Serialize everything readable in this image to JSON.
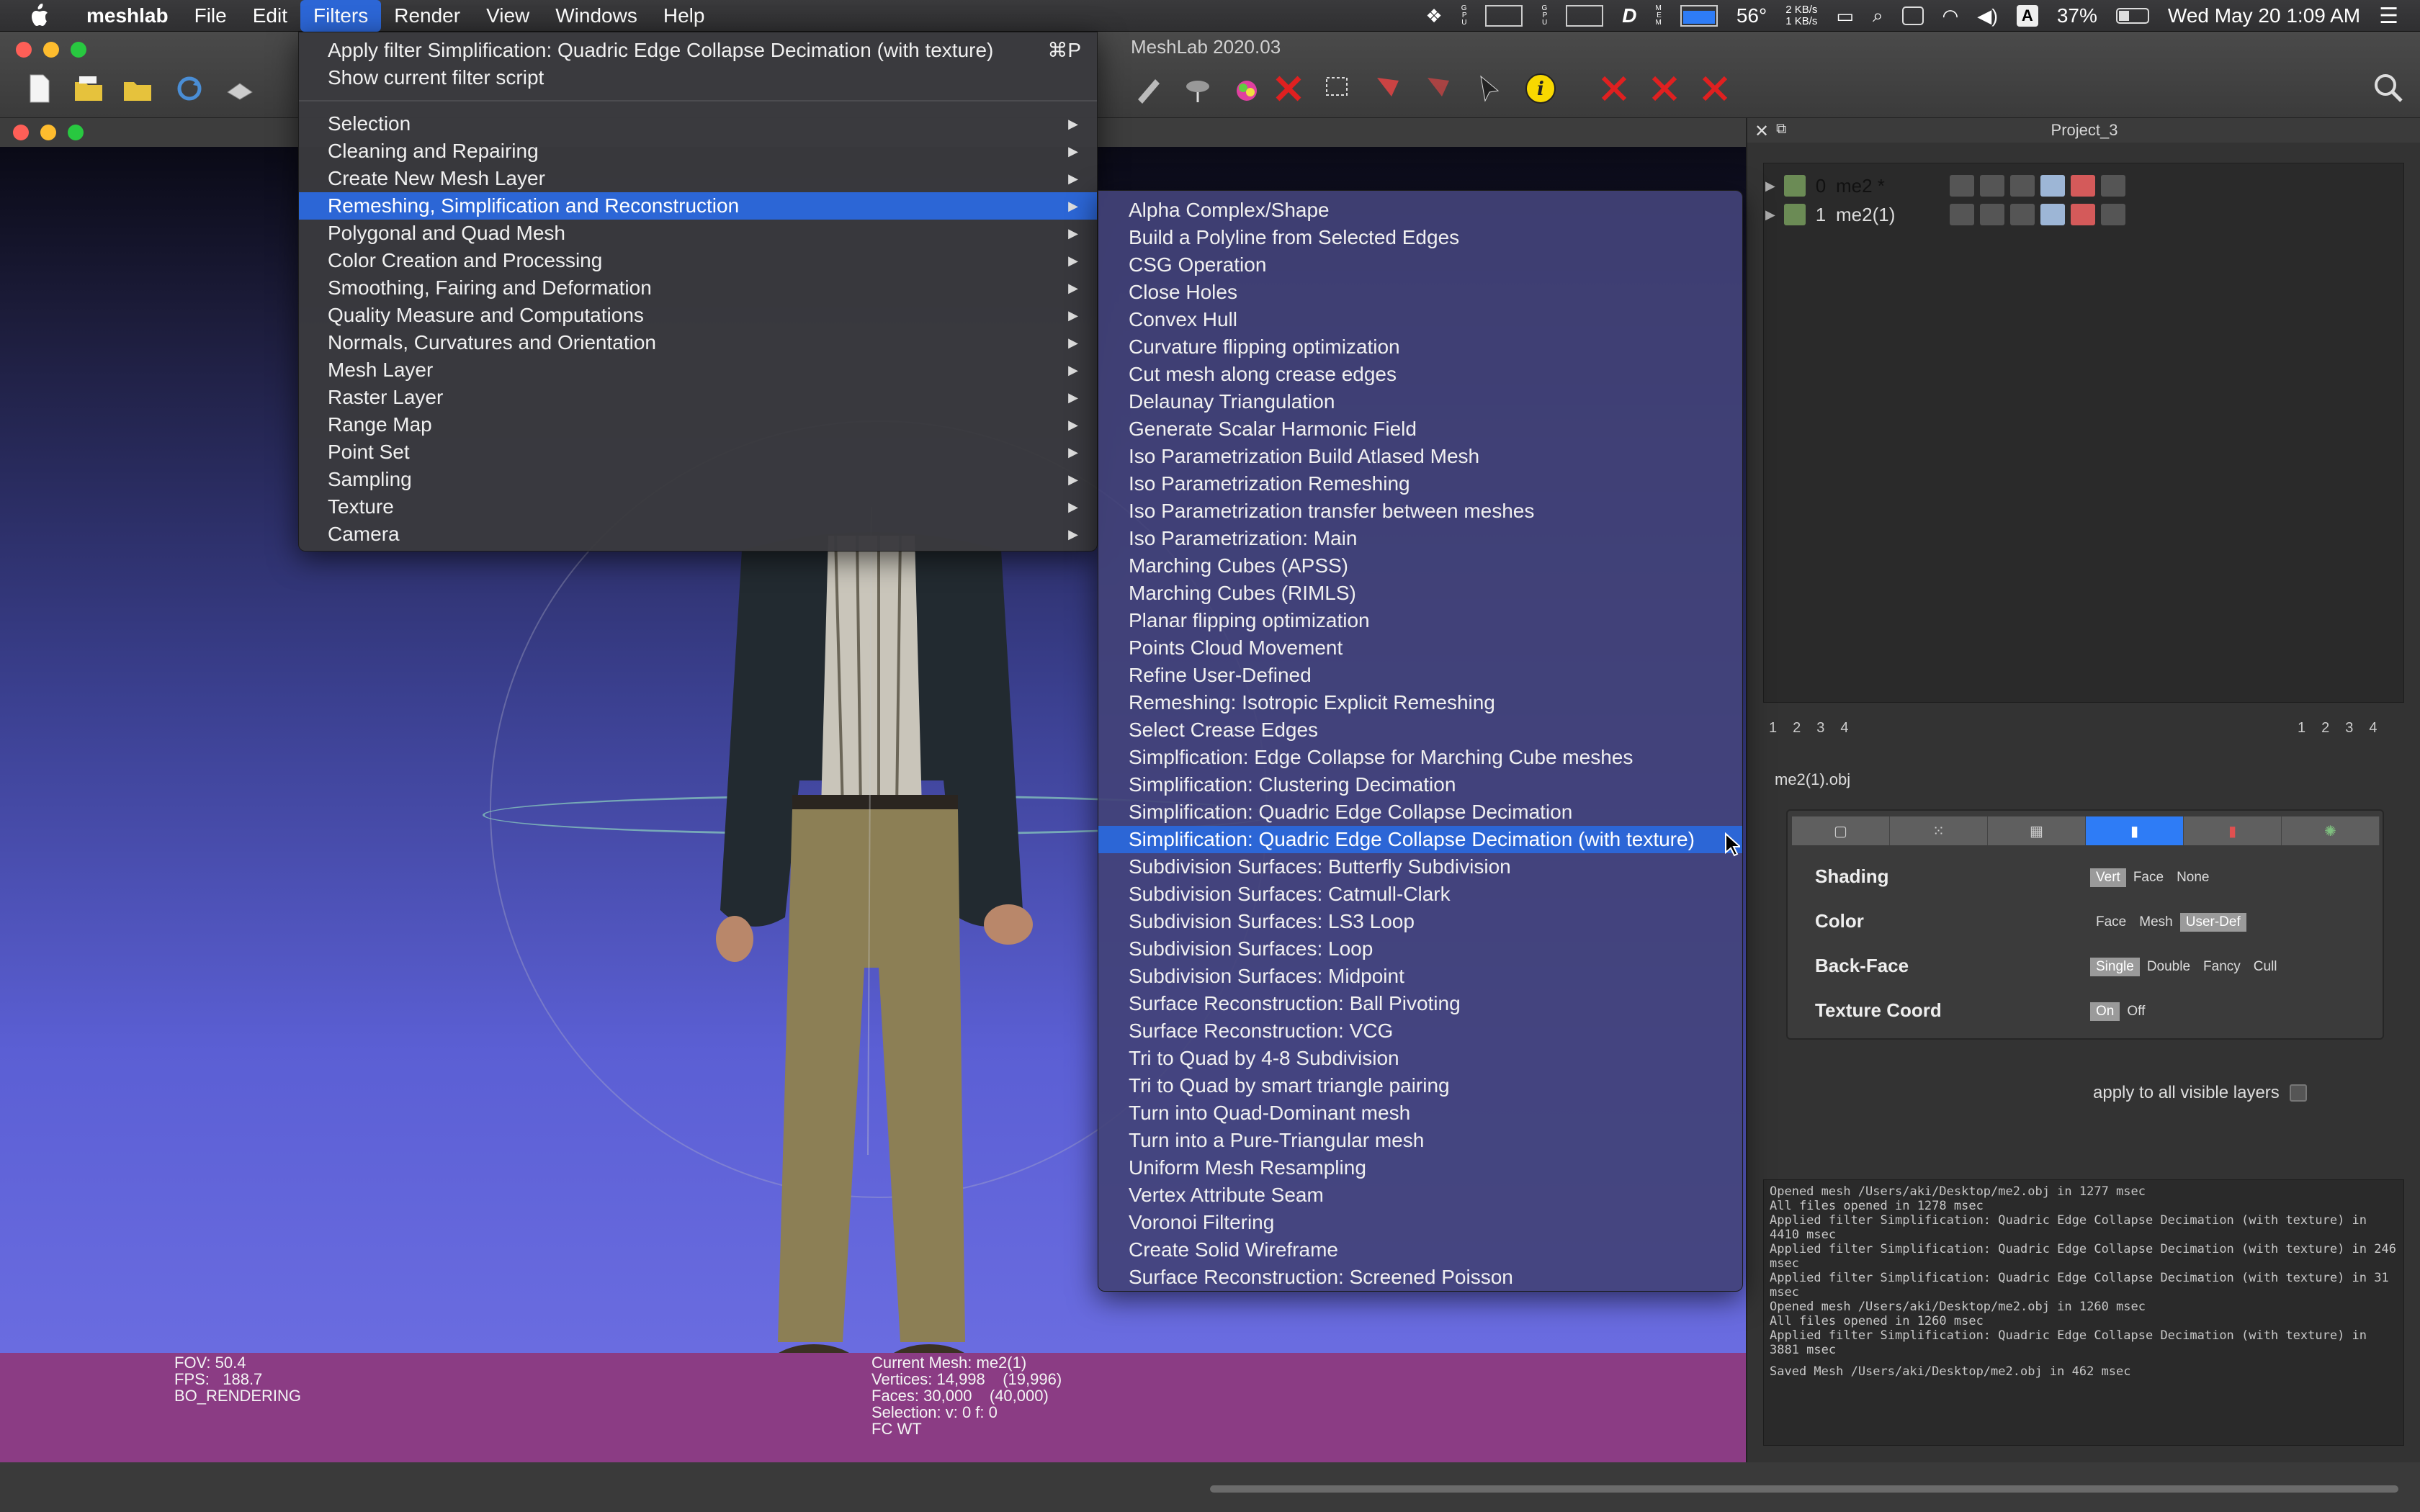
{
  "menubar": {
    "app": "meshlab",
    "menus": [
      "File",
      "Edit",
      "Filters",
      "Render",
      "View",
      "Windows",
      "Help"
    ],
    "active_menu": "Filters",
    "gpu_label_1": "G\nP\nU",
    "gpu_label_2": "G\nP\nU",
    "mem_label": "M\nE\nM",
    "d_label": "D",
    "temp": "56°",
    "net_up": "2 KB/s",
    "net_down": "1 KB/s",
    "a_label": "A",
    "battery": "37%",
    "datetime": "Wed May 20  1:09 AM"
  },
  "window": {
    "title": "MeshLab 2020.03"
  },
  "filters_menu": {
    "apply_last": "Apply filter Simplification: Quadric Edge Collapse Decimation (with texture)",
    "apply_shortcut": "⌘P",
    "show_script": "Show current filter script",
    "categories": [
      "Selection",
      "Cleaning and Repairing",
      "Create New Mesh Layer",
      "Remeshing, Simplification and Reconstruction",
      "Polygonal and Quad Mesh",
      "Color Creation and Processing",
      "Smoothing, Fairing and Deformation",
      "Quality Measure and Computations",
      "Normals, Curvatures and Orientation",
      "Mesh Layer",
      "Raster Layer",
      "Range Map",
      "Point Set",
      "Sampling",
      "Texture",
      "Camera"
    ],
    "highlighted_index": 3
  },
  "remesh_menu": {
    "items": [
      "Alpha Complex/Shape",
      "Build a Polyline from Selected Edges",
      "CSG Operation",
      "Close Holes",
      "Convex Hull",
      "Curvature flipping optimization",
      "Cut mesh along crease edges",
      "Delaunay Triangulation",
      "Generate Scalar Harmonic Field",
      "Iso Parametrization Build Atlased Mesh",
      "Iso Parametrization Remeshing",
      "Iso Parametrization transfer between meshes",
      "Iso Parametrization: Main",
      "Marching Cubes (APSS)",
      "Marching Cubes (RIMLS)",
      "Planar flipping optimization",
      "Points Cloud Movement",
      "Refine User-Defined",
      "Remeshing: Isotropic Explicit Remeshing",
      "Select Crease Edges",
      "Simplfication: Edge Collapse for Marching Cube meshes",
      "Simplification: Clustering Decimation",
      "Simplification: Quadric Edge Collapse Decimation",
      "Simplification: Quadric Edge Collapse Decimation (with texture)",
      "Subdivision Surfaces: Butterfly Subdivision",
      "Subdivision Surfaces: Catmull-Clark",
      "Subdivision Surfaces: LS3 Loop",
      "Subdivision Surfaces: Loop",
      "Subdivision Surfaces: Midpoint",
      "Surface Reconstruction: Ball Pivoting",
      "Surface Reconstruction: VCG",
      "Tri to Quad by 4-8 Subdivision",
      "Tri to Quad by smart triangle pairing",
      "Turn into Quad-Dominant mesh",
      "Turn into a Pure-Triangular mesh",
      "Uniform Mesh Resampling",
      "Vertex Attribute Seam",
      "Voronoi Filtering",
      "Create Solid Wireframe",
      "Surface Reconstruction: Screened Poisson"
    ],
    "highlighted_index": 23
  },
  "viewport_info": {
    "fov": "FOV: 50.4",
    "fps": "FPS:   188.7",
    "mode": "BO_RENDERING",
    "current_mesh": "Current Mesh: me2(1)",
    "vertices": "Vertices: 14,998    (19,996)",
    "faces": "Faces: 30,000    (40,000)",
    "selection": "Selection: v: 0 f: 0",
    "fc": "FC WT"
  },
  "project": {
    "title": "Project_3",
    "layers": [
      {
        "index": "0",
        "name": "me2 *"
      },
      {
        "index": "1",
        "name": "me2(1)"
      }
    ],
    "pager_left": [
      "1",
      "2",
      "3",
      "4"
    ],
    "pager_right": [
      "1",
      "2",
      "3",
      "4"
    ],
    "current_mesh_file": "me2(1).obj"
  },
  "render_props": {
    "shading_label": "Shading",
    "shading_options": [
      "Vert",
      "Face",
      "None"
    ],
    "color_label": "Color",
    "color_options": [
      "Face",
      "Mesh",
      "User-Def"
    ],
    "backface_label": "Back-Face",
    "backface_options": [
      "Single",
      "Double",
      "Fancy",
      "Cull"
    ],
    "texcoord_label": "Texture Coord",
    "texcoord_options": [
      "On",
      "Off"
    ],
    "apply_all": "apply to all visible layers"
  },
  "log": [
    "Opened mesh /Users/aki/Desktop/me2.obj in 1277 msec",
    "All files opened in 1278 msec",
    "Applied filter Simplification: Quadric Edge Collapse Decimation (with texture) in 4410 msec",
    "Applied filter Simplification: Quadric Edge Collapse Decimation (with texture) in 246 msec",
    "Applied filter Simplification: Quadric Edge Collapse Decimation (with texture) in 31 msec",
    "Opened mesh /Users/aki/Desktop/me2.obj in 1260 msec",
    "All files opened in 1260 msec",
    "Applied filter Simplification: Quadric Edge Collapse Decimation (with texture) in 3881 msec",
    "",
    "Saved Mesh /Users/aki/Desktop/me2.obj in 462 msec"
  ],
  "colors": {
    "menu_highlight": "#2c66d6",
    "infobar": "#8b3c84"
  }
}
